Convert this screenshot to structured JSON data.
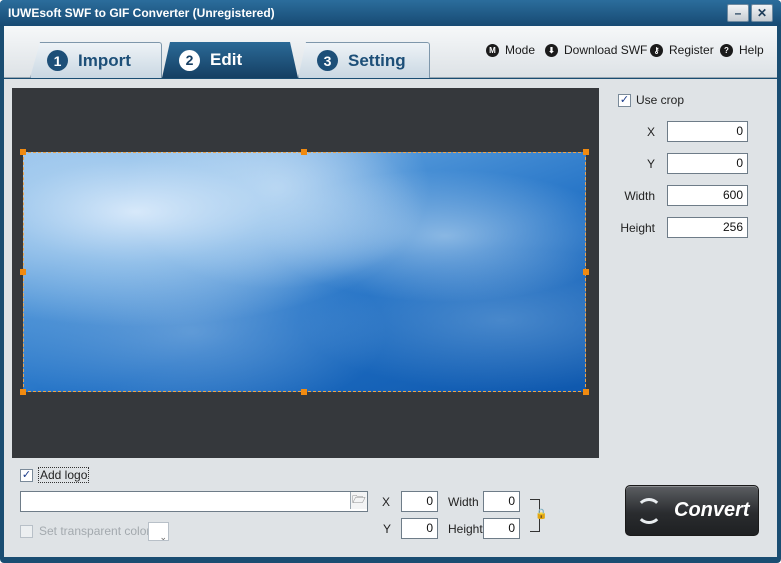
{
  "window": {
    "title": "IUWEsoft SWF to GIF Converter (Unregistered)",
    "minimize_label": "–",
    "close_label": "✕"
  },
  "tabs": [
    {
      "number": "1",
      "label": "Import",
      "active": false
    },
    {
      "number": "2",
      "label": "Edit",
      "active": true
    },
    {
      "number": "3",
      "label": "Setting",
      "active": false
    }
  ],
  "top_menu": [
    {
      "icon": "M",
      "label": "Mode"
    },
    {
      "icon": "⬇",
      "label": "Download SWF"
    },
    {
      "icon": "🔑",
      "label": "Register"
    },
    {
      "icon": "?",
      "label": "Help"
    }
  ],
  "crop": {
    "use_crop_label": "Use crop",
    "use_crop_checked": true,
    "x_label": "X",
    "x_value": "0",
    "y_label": "Y",
    "y_value": "0",
    "width_label": "Width",
    "width_value": "600",
    "height_label": "Height",
    "height_value": "256"
  },
  "logo": {
    "add_logo_label": "Add logo",
    "add_logo_checked": true,
    "path_value": "",
    "transparent_label": "Set transparent color",
    "transparent_checked": false,
    "x_label": "X",
    "x_value": "0",
    "y_label": "Y",
    "y_value": "0",
    "width_label": "Width",
    "width_value": "0",
    "height_label": "Height",
    "height_value": "0"
  },
  "convert": {
    "label": "Convert"
  },
  "colors": {
    "title_bar": "#174a73",
    "active_tab": "#1d4f78",
    "preview_bg": "#35383c",
    "crop_handle": "#f08a10"
  }
}
